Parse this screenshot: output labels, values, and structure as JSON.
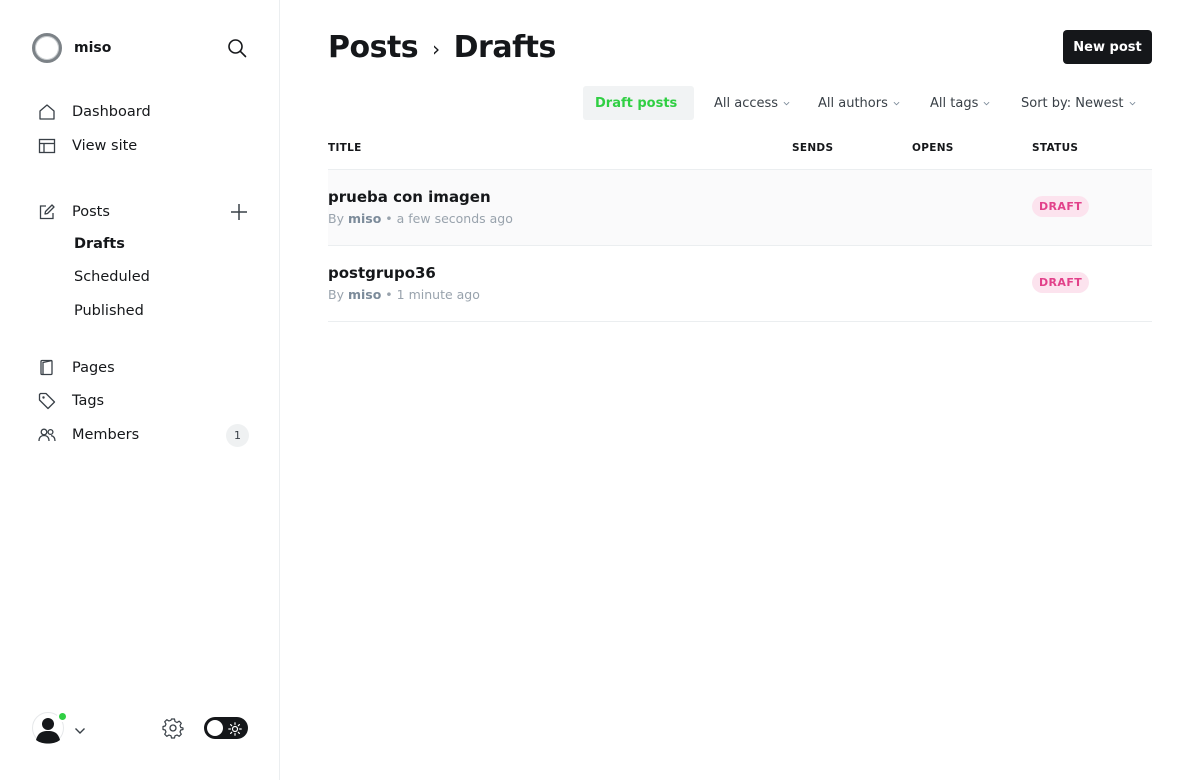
{
  "brand": {
    "name": "miso"
  },
  "sidebar": {
    "nav_main": [
      {
        "label": "Dashboard",
        "icon": "home-icon"
      },
      {
        "label": "View site",
        "icon": "layout-icon"
      }
    ],
    "posts": {
      "label": "Posts",
      "icon": "edit-icon",
      "sub": [
        {
          "label": "Drafts",
          "active": true
        },
        {
          "label": "Scheduled",
          "active": false
        },
        {
          "label": "Published",
          "active": false
        }
      ]
    },
    "nav_secondary": [
      {
        "label": "Pages",
        "icon": "page-icon"
      },
      {
        "label": "Tags",
        "icon": "tag-icon"
      },
      {
        "label": "Members",
        "icon": "members-icon",
        "count": "1"
      }
    ]
  },
  "header": {
    "breadcrumb_root": "Posts",
    "breadcrumb_sep": "›",
    "breadcrumb_current": "Drafts",
    "new_post_label": "New post"
  },
  "filters": {
    "type": "Draft posts",
    "access": "All access",
    "authors": "All authors",
    "tags": "All tags",
    "sort": "Sort by: Newest"
  },
  "table": {
    "columns": [
      "TITLE",
      "SENDS",
      "OPENS",
      "STATUS"
    ],
    "rows": [
      {
        "title": "prueba con imagen",
        "by": "By",
        "author": "miso",
        "time": "• a few seconds ago",
        "status": "DRAFT"
      },
      {
        "title": "postgrupo36",
        "by": "By",
        "author": "miso",
        "time": "• 1 minute ago",
        "status": "DRAFT"
      }
    ]
  },
  "colors": {
    "accent_green": "#30cf43",
    "draft_pink": "#e2418a",
    "draft_bg": "#fce3ee",
    "ink": "#15171a"
  }
}
